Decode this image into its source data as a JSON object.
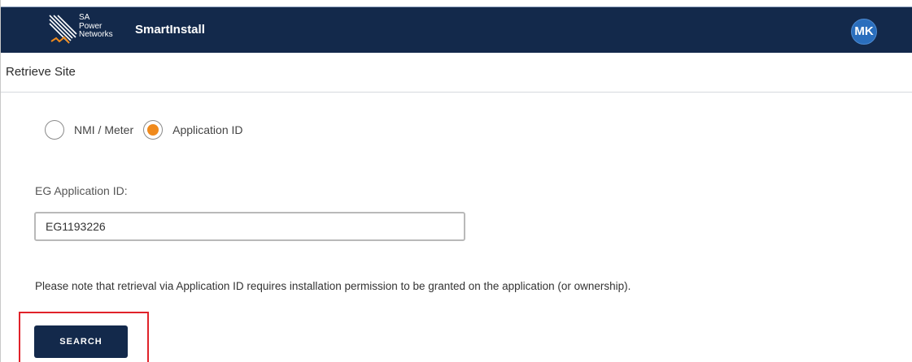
{
  "header": {
    "logo_lines": [
      "SA",
      "Power",
      "Networks"
    ],
    "app_name": "SmartInstall",
    "avatar_initials": "MK"
  },
  "page": {
    "title": "Retrieve Site"
  },
  "search_mode": {
    "options": [
      {
        "label": "NMI / Meter",
        "selected": false
      },
      {
        "label": "Application ID",
        "selected": true
      }
    ]
  },
  "form": {
    "field_label": "EG Application ID:",
    "field_value": "EG1193226",
    "note": "Please note that retrieval via Application ID requires installation permission to be granted on the application (or ownership).",
    "search_label": "SEARCH"
  },
  "colors": {
    "navbar": "#13294b",
    "accent_orange": "#f08a1c",
    "avatar": "#2a6ebd",
    "highlight": "#e0232a"
  }
}
